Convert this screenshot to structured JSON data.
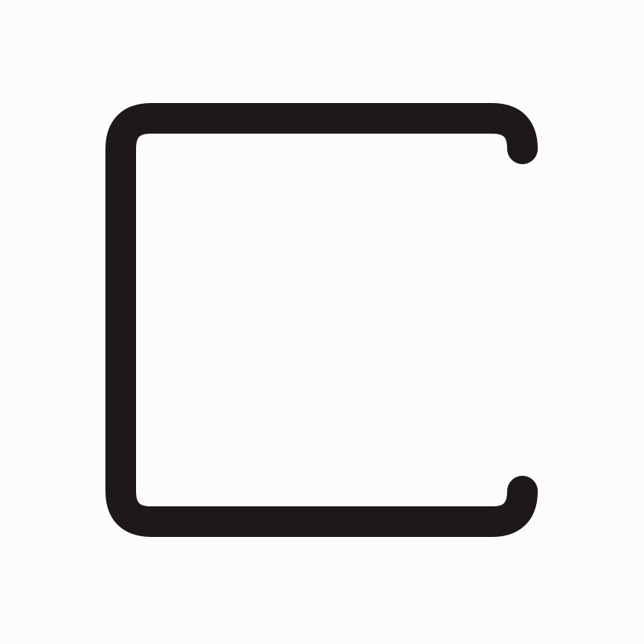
{
  "icon": {
    "name": "open-square-bracket-icon",
    "stroke_color": "#1e181b",
    "background_color": "#fdfcfd"
  }
}
